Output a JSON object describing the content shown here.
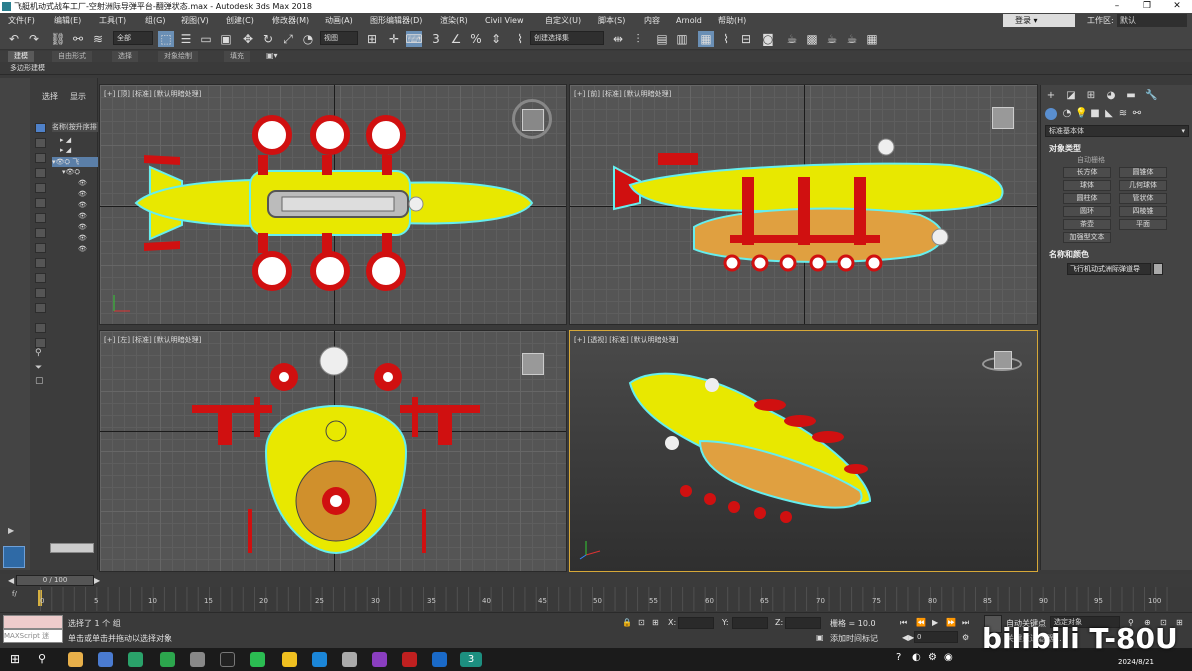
{
  "window": {
    "title": "飞艇机动式战车工厂-空射洲际导弹平台-翻弹状态.max - Autodesk 3ds Max 2018",
    "minimize": "–",
    "maximize": "❐",
    "close": "✕"
  },
  "menu": [
    "文件(F)",
    "编辑(E)",
    "工具(T)",
    "组(G)",
    "视图(V)",
    "创建(C)",
    "修改器(M)",
    "动画(A)",
    "图形编辑器(D)",
    "渲染(R)",
    "Civil View",
    "自定义(U)",
    "脚本(S)",
    "内容",
    "Arnold",
    "帮助(H)"
  ],
  "user": {
    "login": "登录",
    "workspace_label": "工作区:",
    "workspace_value": "默认"
  },
  "toolbar": {
    "filter": "全部",
    "refcoord": "视图",
    "selset": "创建选择集"
  },
  "ribbon": {
    "tabs": [
      "建模",
      "自由形式",
      "选择",
      "对象绘制",
      "填充"
    ],
    "sub": "多边形建模"
  },
  "scene": {
    "tab_select": "选择",
    "tab_display": "显示",
    "header": "名称(按升序排"
  },
  "viewports": {
    "top": "[+] [顶] [标准] [默认明暗处理]",
    "front": "[+] [前] [标准] [默认明暗处理]",
    "left": "[+] [左] [标准] [默认明暗处理]",
    "persp": "[+] [透视] [标准] [默认明暗处理]"
  },
  "cmd": {
    "dropdown": "标准基本体",
    "obj_type": "对象类型",
    "autogrid": "自动栅格",
    "buttons": [
      "长方体",
      "圆锥体",
      "球体",
      "几何球体",
      "圆柱体",
      "管状体",
      "圆环",
      "四棱锥",
      "茶壶",
      "平面",
      "加强型文本"
    ],
    "name_color": "名称和颜色",
    "name_value": "飞行机动式洲际弹道导"
  },
  "time": {
    "frame": "0 / 100",
    "ticks": [
      "0",
      "5",
      "10",
      "15",
      "20",
      "25",
      "30",
      "35",
      "40",
      "45",
      "50",
      "55",
      "60",
      "65",
      "70",
      "75",
      "80",
      "85",
      "90",
      "95",
      "100"
    ]
  },
  "status": {
    "maxscript": "MAXScript 迷",
    "selected": "选择了 1 个 组",
    "prompt": "单击或单击并拖动以选择对象",
    "x": "X:",
    "y": "Y:",
    "z": "Z:",
    "grid": "栅格 = 10.0",
    "addtime": "添加时间标记",
    "autokey": "自动关键点",
    "setkey_dd": "选定对象",
    "keyfilter": "关键点过滤器...",
    "frameval": "0"
  },
  "watermark": "bilibili T-80U",
  "taskbar": {
    "date": "2024/8/21"
  }
}
